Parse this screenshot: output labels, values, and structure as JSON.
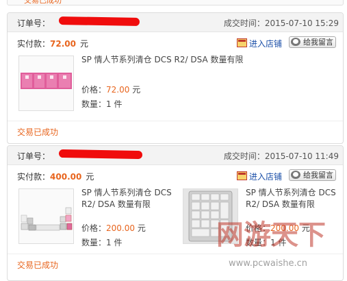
{
  "orders": [
    {
      "order_label": "订单号：",
      "time_label": "成交时间：",
      "time_value": "2015-07-10 15:29",
      "paid_label": "实付款：",
      "paid_amount": "72.00",
      "paid_unit": "元",
      "shop_label": "进入店铺",
      "message_label": "给我留言",
      "status": "交易已成功",
      "items": [
        {
          "title": "SP 情人节系列清仓 DCS R2/ DSA 数量有限",
          "price_label": "价格：",
          "price": "72.00",
          "price_unit": "元",
          "qty_label": "数量：",
          "qty": "1 件",
          "thumb": "pink-keycaps"
        }
      ]
    },
    {
      "order_label": "订单号：",
      "time_label": "成交时间：",
      "time_value": "2015-07-10 11:49",
      "paid_label": "实付款：",
      "paid_amount": "400.00",
      "paid_unit": "元",
      "shop_label": "进入店铺",
      "message_label": "给我留言",
      "status": "交易已成功",
      "items": [
        {
          "title_l1": "SP 情人节系列清仓 DCS",
          "title_l2": "R2/ DSA 数量有限",
          "price_label": "价格：",
          "price": "200.00",
          "price_unit": "元",
          "qty_label": "数量：",
          "qty": "1 件",
          "thumb": "keycap-row"
        },
        {
          "title_l1": "SP 情人节系列清仓 DCS",
          "title_l2": "R2/ DSA 数量有限",
          "price_label": "价格：",
          "price": "200.00",
          "price_unit": "元",
          "qty_label": "数量：",
          "qty": "1 件",
          "thumb": "numpad"
        }
      ]
    }
  ],
  "top_strip_text": "交易已成功",
  "watermark": {
    "brand": "网游天下",
    "url": "www.pcwaishe.cn"
  },
  "colors": {
    "accent": "#e8651e",
    "link": "#1b4fa8",
    "redaction": "#f00c0c"
  }
}
